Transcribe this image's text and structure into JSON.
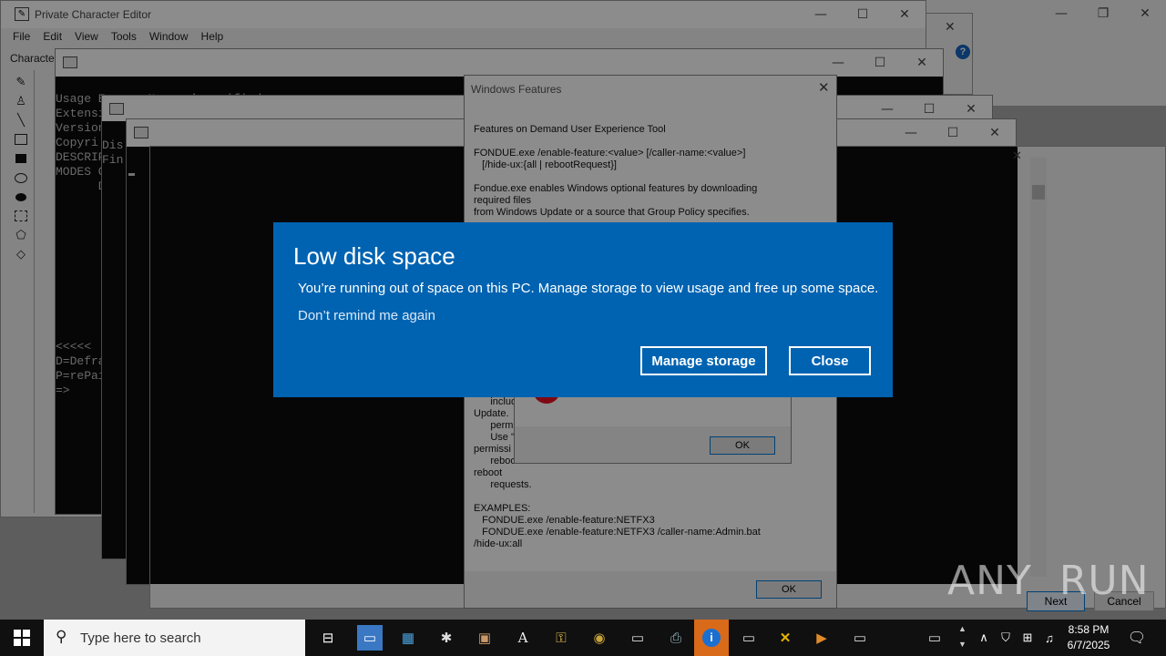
{
  "desktop": {
    "bg_controls": {
      "minimize": "—",
      "restore": "❐",
      "close": "✕"
    }
  },
  "pce": {
    "title": "Private Character Editor",
    "menu": [
      "File",
      "Edit",
      "View",
      "Tools",
      "Window",
      "Help"
    ],
    "char_label": "Characte",
    "help_badge": "?"
  },
  "console1": {
    "lines": [
      "Usage E      N     '    ifi d",
      "",
      "Extensi",
      "Version",
      "Copyri",
      "",
      "DESCRIP",
      "",
      "MODES O",
      "      D"
    ],
    "prompt_lines": [
      "<<<<<",
      "D=Defra",
      "P=rePai",
      "=>"
    ]
  },
  "console2": {
    "lines": [
      "Dis",
      "Fin"
    ]
  },
  "windows_features": {
    "title": "Windows Features",
    "body_top": [
      "Features on Demand User Experience Tool",
      "",
      "FONDUE.exe /enable-feature:<value> [/caller-name:<value>]",
      "   [/hide-ux:{all | rebootRequest}]",
      "",
      "Fondue.exe enables Windows optional features by downloading",
      "required files",
      "from Windows Update or a source that Group Policy specifies."
    ],
    "body_mid": [
      "      includ",
      "Update.",
      "      permi",
      "      Use \"r",
      "permissi",
      "      reboo",
      "reboot",
      "      requests."
    ],
    "body_bottom": [
      "EXAMPLES:",
      "   FONDUE.exe /enable-feature:NETFX3",
      "   FONDUE.exe /enable-feature:NETFX3 /caller-name:Admin.bat",
      "/hide-ux:all"
    ],
    "ok_label": "OK"
  },
  "error_dialog": {
    "ok_label": "OK"
  },
  "wizard": {
    "next_label": "Next",
    "cancel_label": "Cancel"
  },
  "toast": {
    "title": "Low disk space",
    "message": "You’re running out of space on this PC. Manage storage to view usage and free up some space.",
    "dont_remind": "Don’t remind me again",
    "manage_label": "Manage storage",
    "close_label": "Close"
  },
  "watermark": "ANY  RUN",
  "taskbar": {
    "search_placeholder": "Type here to search",
    "time": "8:58 PM",
    "date": "6/7/2025",
    "accent": "#0063b1"
  }
}
